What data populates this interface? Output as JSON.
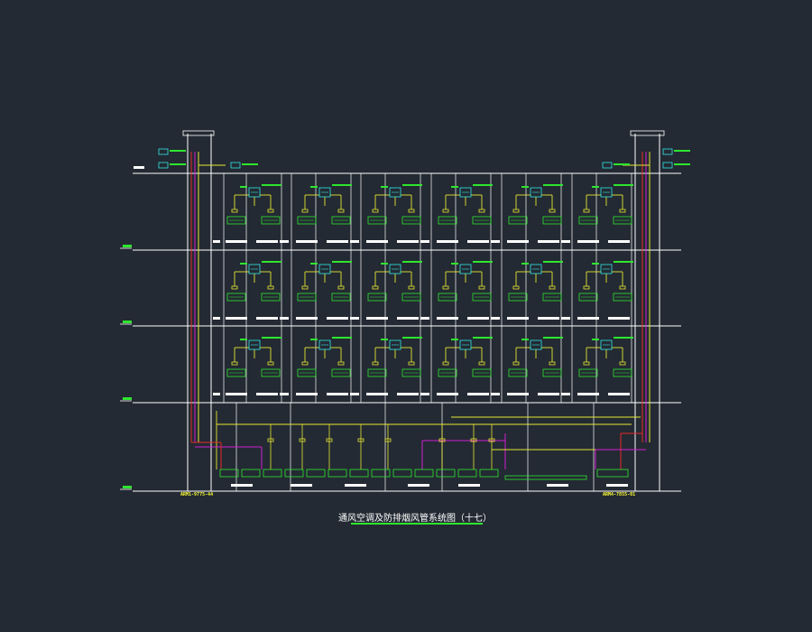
{
  "drawing": {
    "title": "通风空调及防排烟风管系统图（十七）",
    "left_riser_tag": "ARM1-9775-44",
    "right_riser_tag": "ARM4-7855-01"
  },
  "colors": {
    "background": "#232a33",
    "structure": "#ffffff",
    "duct_yellow": "#e6e632",
    "duct_red": "#e62a2a",
    "duct_magenta": "#d21ed2",
    "label_green": "#2ee62e",
    "label_cyan": "#32e6e6",
    "title_underline": "#2ee62e"
  },
  "icons": {
    "fan_coil": "fan-coil-icon",
    "damper": "fire-damper-icon",
    "equipment_tag": "equipment-tag-icon"
  }
}
